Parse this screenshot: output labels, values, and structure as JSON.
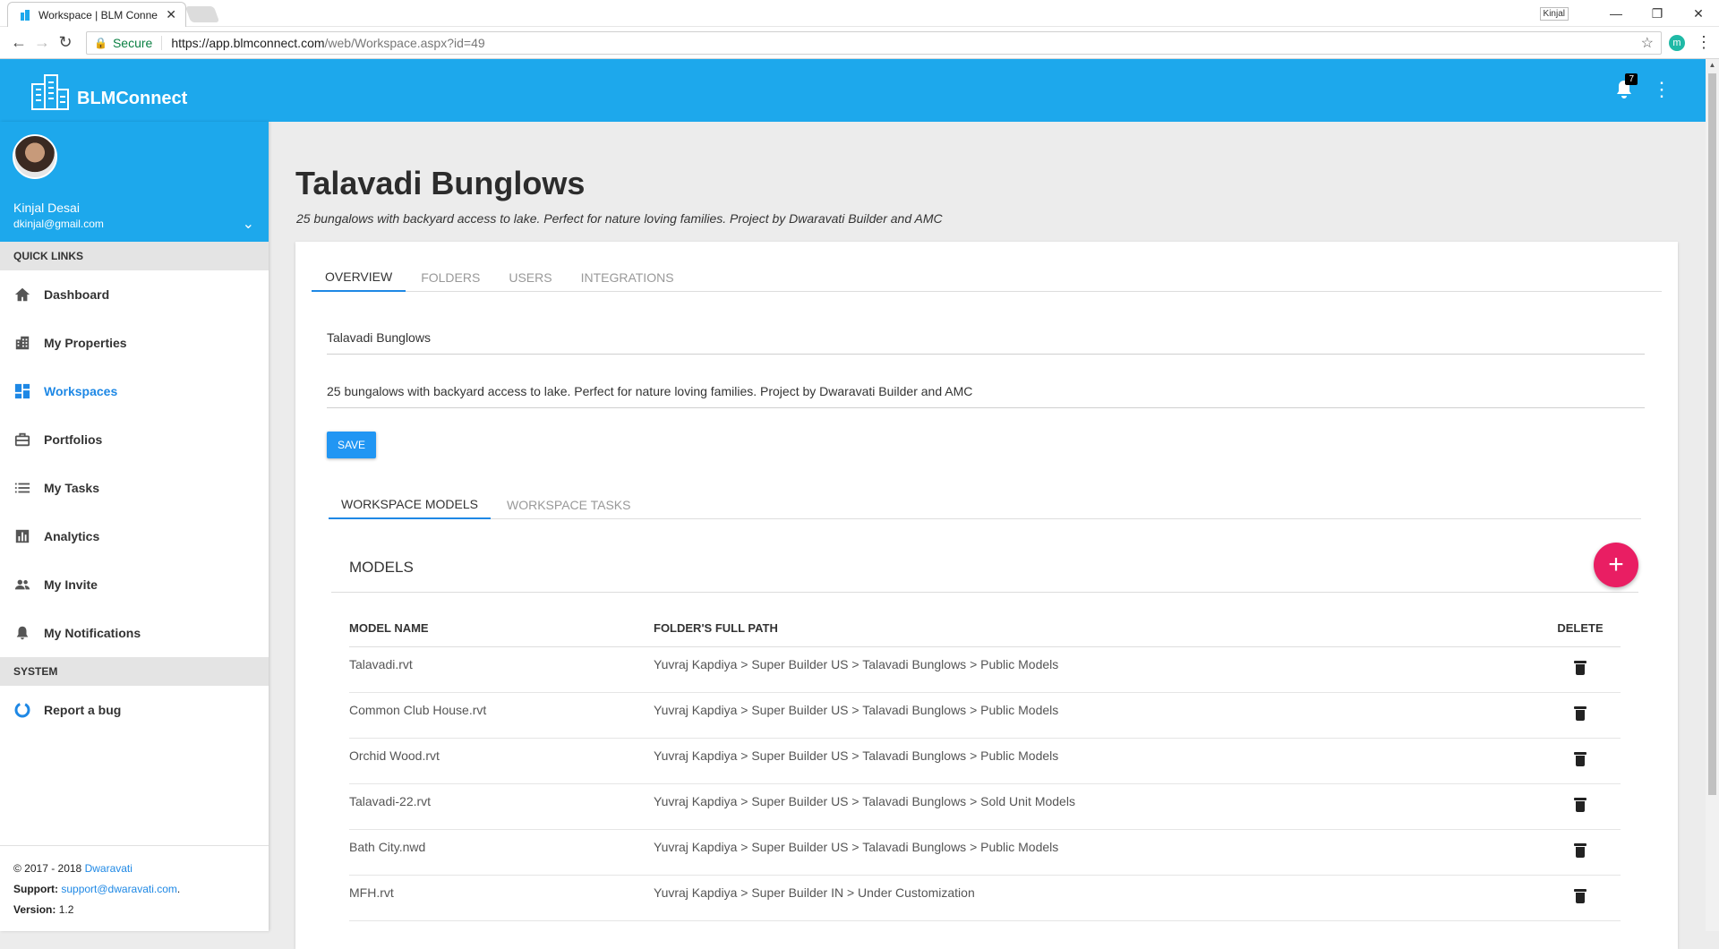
{
  "browser": {
    "tab_title": "Workspace | BLM Conne",
    "secure_label": "Secure",
    "url_main": "https://app.blmconnect.com",
    "url_path": "/web/Workspace.aspx?id=49",
    "user_chip": "Kinjal",
    "ext_label": "m"
  },
  "app": {
    "brand": "BLMConnect",
    "notification_count": "7"
  },
  "profile": {
    "name": "Kinjal Desai",
    "email": "dkinjal@gmail.com"
  },
  "sidebar": {
    "quick_links_label": "QUICK LINKS",
    "items": [
      {
        "label": "Dashboard",
        "icon": "home-icon"
      },
      {
        "label": "My Properties",
        "icon": "building-icon"
      },
      {
        "label": "Workspaces",
        "icon": "dashboard-grid-icon"
      },
      {
        "label": "Portfolios",
        "icon": "briefcase-icon"
      },
      {
        "label": "My Tasks",
        "icon": "list-icon"
      },
      {
        "label": "Analytics",
        "icon": "bar-chart-icon"
      },
      {
        "label": "My Invite",
        "icon": "people-icon"
      },
      {
        "label": "My Notifications",
        "icon": "bell-icon"
      }
    ],
    "system_label": "SYSTEM",
    "report_bug": "Report a bug"
  },
  "footer": {
    "copyright": "© 2017 - 2018",
    "company": "Dwaravati",
    "support_label": "Support:",
    "support_email": "support@dwaravati.com",
    "version_label": "Version:",
    "version": "1.2"
  },
  "page": {
    "title": "Talavadi Bunglows",
    "subtitle": "25 bungalows with backyard access to lake. Perfect for nature loving families. Project by Dwaravati Builder and AMC"
  },
  "tabs": [
    "OVERVIEW",
    "FOLDERS",
    "USERS",
    "INTEGRATIONS"
  ],
  "overview": {
    "name_value": "Talavadi Bunglows",
    "description_value": "25 bungalows with backyard access to lake. Perfect for nature loving families. Project by Dwaravati Builder and AMC",
    "save_label": "SAVE"
  },
  "subtabs": [
    "WORKSPACE MODELS",
    "WORKSPACE TASKS"
  ],
  "models": {
    "heading": "MODELS",
    "add_label": "+",
    "columns": [
      "MODEL NAME",
      "FOLDER'S FULL PATH",
      "DELETE"
    ],
    "rows": [
      {
        "name": "Talavadi.rvt",
        "path": "Yuvraj Kapdiya > Super Builder US > Talavadi Bunglows > Public Models"
      },
      {
        "name": "Common Club House.rvt",
        "path": "Yuvraj Kapdiya > Super Builder US > Talavadi Bunglows > Public Models"
      },
      {
        "name": "Orchid Wood.rvt",
        "path": "Yuvraj Kapdiya > Super Builder US > Talavadi Bunglows > Public Models"
      },
      {
        "name": "Talavadi-22.rvt",
        "path": "Yuvraj Kapdiya > Super Builder US > Talavadi Bunglows > Sold Unit Models"
      },
      {
        "name": "Bath City.nwd",
        "path": "Yuvraj Kapdiya > Super Builder US > Talavadi Bunglows > Public Models"
      },
      {
        "name": "MFH.rvt",
        "path": "Yuvraj Kapdiya > Super Builder IN > Under Customization"
      }
    ]
  }
}
